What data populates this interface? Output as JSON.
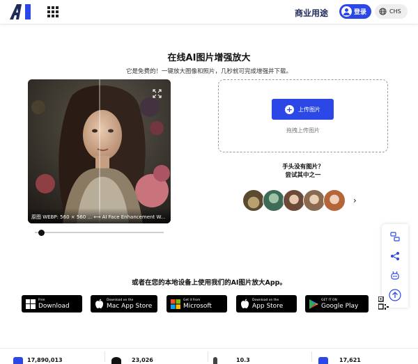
{
  "header": {
    "logo_text": "AI",
    "nav_business": "商业用途",
    "login_label": "登录",
    "language_label": "CHS"
  },
  "main": {
    "title": "在线AI图片增强放大",
    "subtitle": "它是免费的！一键放大图像和照片，几秒就可完成增强并下载。",
    "preview_caption": "原图 WEBP: 560 × 560 ... ⟷ AI Face Enhancement W...",
    "slider_value": 0.05
  },
  "upload": {
    "button_label": "上传图片",
    "drag_text": "拖拽上传图片",
    "no_image_line1": "手头没有图片？",
    "no_image_line2": "尝试其中之一"
  },
  "apps": {
    "heading": "或者在您的本地设备上使用我们的AI图片放大App。",
    "stores": [
      {
        "small": "Free",
        "big": "Download",
        "icon": "windows-icon"
      },
      {
        "small": "Download on the",
        "big": "Mac App Store",
        "icon": "apple-icon"
      },
      {
        "small": "Get it from",
        "big": "Microsoft",
        "icon": "microsoft-icon"
      },
      {
        "small": "Download on the",
        "big": "App Store",
        "icon": "apple-icon"
      },
      {
        "small": "GET IT ON",
        "big": "Google Play",
        "icon": "google-play-icon"
      }
    ]
  },
  "stats": [
    "17,890,013",
    "23,026",
    "10.3",
    "17,621"
  ],
  "colors": {
    "accent": "#2b48e6",
    "navy": "#1e2a5a"
  }
}
